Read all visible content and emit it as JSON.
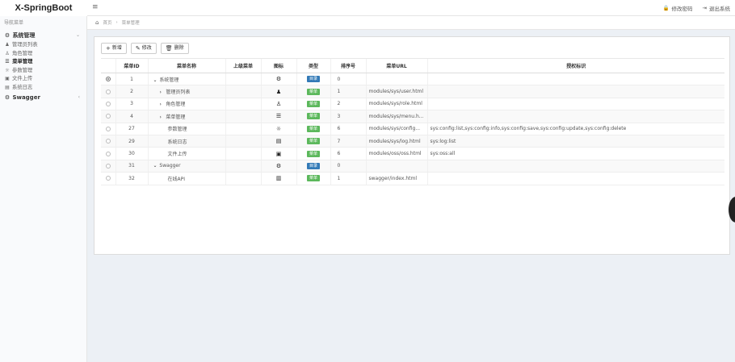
{
  "app": {
    "title": "X-SpringBoot"
  },
  "header": {
    "menu_toggle": "≡",
    "actions": [
      {
        "label": "修改密码",
        "icon": "lock-icon",
        "glyph": "🔒"
      },
      {
        "label": "退出系统",
        "icon": "logout-icon",
        "glyph": "⇥"
      }
    ]
  },
  "sidebar": {
    "heading": "导航菜单",
    "groups": [
      {
        "label": "系统管理",
        "icon": "gear-icon",
        "glyph": "⚙",
        "chevron": "⌄",
        "items": [
          {
            "label": "管理员列表",
            "icon": "user-icon",
            "glyph": "♟"
          },
          {
            "label": "角色管理",
            "icon": "user-secret-icon",
            "glyph": "♙"
          },
          {
            "label": "菜单管理",
            "icon": "list-icon",
            "glyph": "☰",
            "active": true
          },
          {
            "label": "参数管理",
            "icon": "sun-icon",
            "glyph": "☼"
          },
          {
            "label": "文件上传",
            "icon": "file-image-icon",
            "glyph": "▣"
          },
          {
            "label": "系统日志",
            "icon": "file-text-icon",
            "glyph": "▤"
          }
        ]
      },
      {
        "label": "Swagger",
        "icon": "gear-icon",
        "glyph": "⚙",
        "chevron": "‹"
      }
    ]
  },
  "breadcrumb": {
    "home": "首页",
    "separator": "›",
    "current": "菜单管理"
  },
  "toolbar": {
    "add": {
      "label": "新增",
      "glyph": "+"
    },
    "edit": {
      "label": "修改",
      "glyph": "✎"
    },
    "delete": {
      "label": "删除",
      "glyph": "🗑"
    }
  },
  "table": {
    "columns": [
      "",
      "菜单ID",
      "菜单名称",
      "上级菜单",
      "图标",
      "类型",
      "排序号",
      "菜单URL",
      "授权标识"
    ],
    "rows": [
      {
        "selected": true,
        "id": "1",
        "name": "系统管理",
        "indent": 0,
        "arrow": "⌄",
        "parent": "",
        "icon": "gear-icon",
        "glyph": "⚙",
        "type": "目录",
        "type_color": "#337ab7",
        "order": "0",
        "url": "",
        "perms": ""
      },
      {
        "selected": false,
        "id": "2",
        "name": "管理员列表",
        "indent": 1,
        "arrow": "›",
        "parent": "",
        "icon": "user-icon",
        "glyph": "♟",
        "type": "菜单",
        "type_color": "#5cb85c",
        "order": "1",
        "url": "modules/sys/user.html",
        "perms": ""
      },
      {
        "selected": false,
        "id": "3",
        "name": "角色管理",
        "indent": 1,
        "arrow": "›",
        "parent": "",
        "icon": "user-secret-icon",
        "glyph": "♙",
        "type": "菜单",
        "type_color": "#5cb85c",
        "order": "2",
        "url": "modules/sys/role.html",
        "perms": ""
      },
      {
        "selected": false,
        "id": "4",
        "name": "菜单管理",
        "indent": 1,
        "arrow": "›",
        "parent": "",
        "icon": "list-icon",
        "glyph": "☰",
        "type": "菜单",
        "type_color": "#5cb85c",
        "order": "3",
        "url": "modules/sys/menu.h...",
        "perms": ""
      },
      {
        "selected": false,
        "id": "27",
        "name": "参数管理",
        "indent": 2,
        "arrow": "",
        "parent": "",
        "icon": "sun-icon",
        "glyph": "☼",
        "type": "菜单",
        "type_color": "#5cb85c",
        "order": "6",
        "url": "modules/sys/config...",
        "perms": "sys:config:list,sys:config:info,sys:config:save,sys:config:update,sys:config:delete"
      },
      {
        "selected": false,
        "id": "29",
        "name": "系统日志",
        "indent": 2,
        "arrow": "",
        "parent": "",
        "icon": "file-text-icon",
        "glyph": "▤",
        "type": "菜单",
        "type_color": "#5cb85c",
        "order": "7",
        "url": "modules/sys/log.html",
        "perms": "sys:log:list"
      },
      {
        "selected": false,
        "id": "30",
        "name": "文件上传",
        "indent": 2,
        "arrow": "",
        "parent": "",
        "icon": "file-image-icon",
        "glyph": "▣",
        "type": "菜单",
        "type_color": "#5cb85c",
        "order": "6",
        "url": "modules/oss/oss.html",
        "perms": "sys:oss:all"
      },
      {
        "selected": false,
        "id": "31",
        "name": "Swagger",
        "indent": 0,
        "arrow": "⌄",
        "parent": "",
        "icon": "gear-icon",
        "glyph": "⚙",
        "type": "目录",
        "type_color": "#337ab7",
        "order": "0",
        "url": "",
        "perms": ""
      },
      {
        "selected": false,
        "id": "32",
        "name": "在线API",
        "indent": 2,
        "arrow": "",
        "parent": "",
        "icon": "file-code-icon",
        "glyph": "▥",
        "type": "菜单",
        "type_color": "#5cb85c",
        "order": "1",
        "url": "swagger/index.html",
        "perms": ""
      }
    ]
  }
}
